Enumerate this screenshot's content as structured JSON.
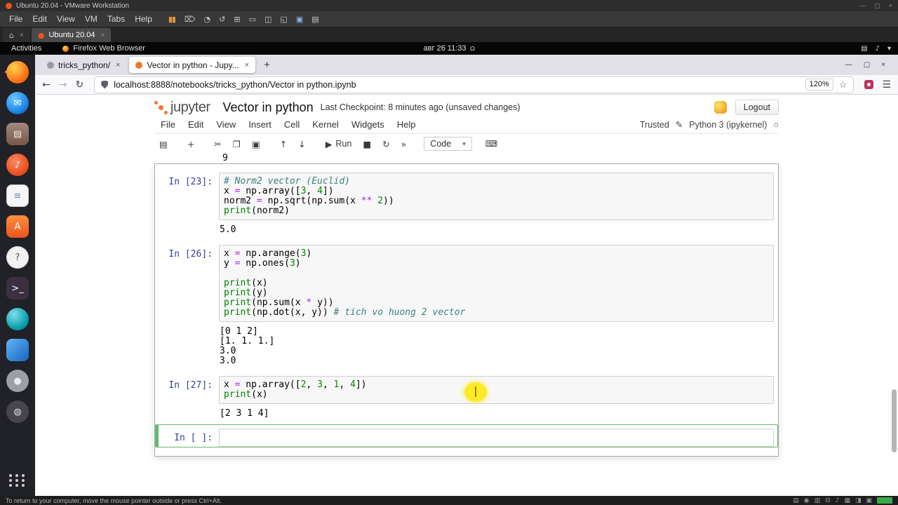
{
  "vmware": {
    "window_title": "Ubuntu 20.04 - VMware Workstation",
    "menu": [
      "File",
      "Edit",
      "View",
      "VM",
      "Tabs",
      "Help"
    ],
    "toolbar_icons": [
      {
        "name": "pause-icon",
        "glyph": "▮▮",
        "color": "#e09a3c"
      },
      {
        "name": "send-ctrl-alt-del-icon",
        "glyph": "⌦",
        "color": "#c9c9c9"
      },
      {
        "name": "snapshot-icon",
        "glyph": "◔",
        "color": "#c9c9c9"
      },
      {
        "name": "revert-snapshot-icon",
        "glyph": "↺",
        "color": "#c9c9c9"
      },
      {
        "name": "snapshot-manager-icon",
        "glyph": "⊞",
        "color": "#c9c9c9"
      },
      {
        "name": "show-console-icon",
        "glyph": "▭",
        "color": "#c9c9c9"
      },
      {
        "name": "console-view-icon",
        "glyph": "◫",
        "color": "#c9c9c9"
      },
      {
        "name": "fullscreen-icon",
        "glyph": "◱",
        "color": "#c9c9c9"
      },
      {
        "name": "unity-mode-icon",
        "glyph": "▣",
        "color": "#8ab4e8"
      },
      {
        "name": "library-icon",
        "glyph": "▤",
        "color": "#c9c9c9"
      }
    ],
    "tabs": [
      {
        "name": "home-tab",
        "glyph": "⌂",
        "label": "",
        "close": "×"
      },
      {
        "name": "ubuntu-tab",
        "glyph": "●",
        "glyph_color": "#e95420",
        "label": "Ubuntu 20.04",
        "close": "×",
        "active": true
      }
    ],
    "window_controls": [
      "—",
      "▢",
      "×"
    ],
    "device_icons": [
      "▤",
      "◉",
      "▥",
      "⊟",
      "♪",
      "▦",
      "◨",
      "▣"
    ],
    "status_message": "To return to your computer, move the mouse pointer outside or press Ctrl+Alt."
  },
  "ubuntu": {
    "activities_label": "Activities",
    "focused_app": "Firefox Web Browser",
    "clock": "авг 26 11:33",
    "topbar_right_icons": [
      {
        "name": "screen-icon",
        "glyph": "▤"
      },
      {
        "name": "volume-icon",
        "glyph": "♪"
      },
      {
        "name": "power-menu-icon",
        "glyph": "▾"
      }
    ],
    "dock": [
      {
        "name": "firefox",
        "shape": "circle",
        "bg": "radial-gradient(circle at 35% 30%, #ffd54f, #ff7d1a 55%, #e65100)",
        "glyph": "",
        "running": true
      },
      {
        "name": "thunderbird",
        "shape": "circle",
        "bg": "radial-gradient(circle at 35% 30%, #6ec6ff, #1e88e5 60%, #0d47a1)",
        "glyph": "✉",
        "fg": "#ffffff"
      },
      {
        "name": "files",
        "shape": "square",
        "bg": "linear-gradient(#a1887f, #795548)",
        "glyph": "▤",
        "fg": "#efe6df"
      },
      {
        "name": "rhythmbox",
        "shape": "circle",
        "bg": "radial-gradient(circle at 40% 35%, #ff8a65, #e64a19 70%)",
        "glyph": "♪",
        "fg": "#ffffff"
      },
      {
        "name": "libreoffice-writer",
        "shape": "square",
        "bg": "#f5f5f5",
        "glyph": "≡",
        "fg": "#6f8fb0",
        "border": "#c9c9c9"
      },
      {
        "name": "ubuntu-software",
        "shape": "square",
        "bg": "linear-gradient(#ff8f3e, #e95420)",
        "glyph": "A",
        "fg": "#ffffff"
      },
      {
        "name": "help",
        "shape": "circle",
        "bg": "#f2f2f2",
        "glyph": "?",
        "fg": "#555555",
        "border": "#cccccc"
      },
      {
        "name": "terminal",
        "shape": "square",
        "bg": "#3c2f41",
        "glyph": ">_",
        "fg": "#ffffff"
      },
      {
        "name": "software-updater",
        "shape": "circle",
        "bg": "radial-gradient(circle at 35% 30%, #80deea, #0097a7 70%)",
        "glyph": "",
        "fg": "#ffffff"
      },
      {
        "name": "vscode",
        "shape": "square",
        "bg": "linear-gradient(135deg, #64b5f6, #1565c0)",
        "glyph": "",
        "fg": "#ffffff"
      },
      {
        "name": "screenshot-tool",
        "shape": "circle",
        "bg": "#9aa0a6",
        "glyph": "●",
        "fg": "#e8eaed"
      },
      {
        "name": "settings",
        "shape": "circle",
        "bg": "#49454d",
        "glyph": "◍",
        "fg": "#dddddd"
      }
    ]
  },
  "firefox": {
    "tabs": [
      {
        "name": "tab-tricks-python",
        "label": "tricks_python/",
        "close": "×",
        "favicon": "#9a9aa2"
      },
      {
        "name": "tab-vector-notebook",
        "label": "Vector in python - Jupy...",
        "close": "×",
        "favicon": "#f37726",
        "active": true
      }
    ],
    "new_tab_glyph": "+",
    "window_controls": [
      "—",
      "▢",
      "×"
    ],
    "nav": {
      "back": "←",
      "forward": "→",
      "reload": "↻"
    },
    "url": "localhost:8888/notebooks/tricks_python/Vector in python.ipynb",
    "zoom_level": "120%",
    "bookmark_star": "☆",
    "menu_glyph": "☰"
  },
  "jupyter": {
    "logo_text": "jupyter",
    "notebook_title": "Vector in python",
    "checkpoint": "Last Checkpoint: 8 minutes ago",
    "unsaved": "(unsaved changes)",
    "logout_label": "Logout",
    "menu": [
      "File",
      "Edit",
      "View",
      "Insert",
      "Cell",
      "Kernel",
      "Widgets",
      "Help"
    ],
    "trusted_label": "Trusted",
    "edit_icon": "✎",
    "kernel_name": "Python 3 (ipykernel)",
    "kernel_status_glyph": "○",
    "toolbar": {
      "buttons": [
        {
          "name": "save-button",
          "glyph": "▤",
          "gap": true
        },
        {
          "name": "insert-cell-button",
          "glyph": "+",
          "gap": true
        },
        {
          "name": "cut-cells-button",
          "glyph": "✂"
        },
        {
          "name": "copy-cells-button",
          "glyph": "❐"
        },
        {
          "name": "paste-cells-button",
          "glyph": "▣",
          "gap": true
        },
        {
          "name": "move-up-button",
          "glyph": "↑"
        },
        {
          "name": "move-down-button",
          "glyph": "↓",
          "gap": true
        },
        {
          "name": "run-button",
          "glyph": "▶",
          "label": "Run"
        },
        {
          "name": "stop-button",
          "glyph": "■"
        },
        {
          "name": "restart-kernel-button",
          "glyph": "↻"
        },
        {
          "name": "restart-run-all-button",
          "glyph": "»",
          "gap": true
        }
      ],
      "cell_type": "Code",
      "cell_type_caret": "▾",
      "palette_glyph": "⌨"
    },
    "cells": [
      {
        "peek": true,
        "output": [
          "9"
        ]
      },
      {
        "prompt": "In [23]:",
        "code": [
          [
            [
              "com",
              "# Norm2 vector (Euclid)"
            ]
          ],
          [
            [
              "",
              "x "
            ],
            [
              "op",
              "="
            ],
            [
              "",
              " np.array(["
            ],
            [
              "num",
              "3"
            ],
            [
              "",
              ", "
            ],
            [
              "num",
              "4"
            ],
            [
              "",
              "])"
            ]
          ],
          [
            [
              "",
              "norm2 "
            ],
            [
              "op",
              "="
            ],
            [
              "",
              " np.sqrt(np.sum(x "
            ],
            [
              "op",
              "**"
            ],
            [
              "",
              " "
            ],
            [
              "num",
              "2"
            ],
            [
              "",
              "))"
            ]
          ],
          [
            [
              "fn",
              "print"
            ],
            [
              "",
              "(norm2)"
            ]
          ]
        ],
        "output": [
          "5.0"
        ]
      },
      {
        "prompt": "In [26]:",
        "code": [
          [
            [
              "",
              "x "
            ],
            [
              "op",
              "="
            ],
            [
              "",
              " np.arange("
            ],
            [
              "num",
              "3"
            ],
            [
              "",
              ")"
            ]
          ],
          [
            [
              "",
              "y "
            ],
            [
              "op",
              "="
            ],
            [
              "",
              " np.ones("
            ],
            [
              "num",
              "3"
            ],
            [
              "",
              ")"
            ]
          ],
          [],
          [
            [
              "fn",
              "print"
            ],
            [
              "",
              "(x)"
            ]
          ],
          [
            [
              "fn",
              "print"
            ],
            [
              "",
              "(y)"
            ]
          ],
          [
            [
              "fn",
              "print"
            ],
            [
              "",
              "(np.sum(x "
            ],
            [
              "op",
              "*"
            ],
            [
              "",
              " y))"
            ]
          ],
          [
            [
              "fn",
              "print"
            ],
            [
              "",
              "(np.dot(x, y)) "
            ],
            [
              "com",
              "# tich vo huong 2 vector"
            ]
          ]
        ],
        "output": [
          "[0 1 2]",
          "[1. 1. 1.]",
          "3.0",
          "3.0"
        ]
      },
      {
        "prompt": "In [27]:",
        "code": [
          [
            [
              "",
              "x "
            ],
            [
              "op",
              "="
            ],
            [
              "",
              " np.array(["
            ],
            [
              "num",
              "2"
            ],
            [
              "",
              ", "
            ],
            [
              "num",
              "3"
            ],
            [
              "",
              ", "
            ],
            [
              "num",
              "1"
            ],
            [
              "",
              ", "
            ],
            [
              "num",
              "4"
            ],
            [
              "",
              "])"
            ]
          ],
          [
            [
              "fn",
              "print"
            ],
            [
              "",
              "(x)"
            ]
          ]
        ],
        "output": [
          "[2 3 1 4]"
        ]
      },
      {
        "prompt": "In [ ]:",
        "code": [
          []
        ],
        "selected": true,
        "cursor": true
      }
    ]
  }
}
